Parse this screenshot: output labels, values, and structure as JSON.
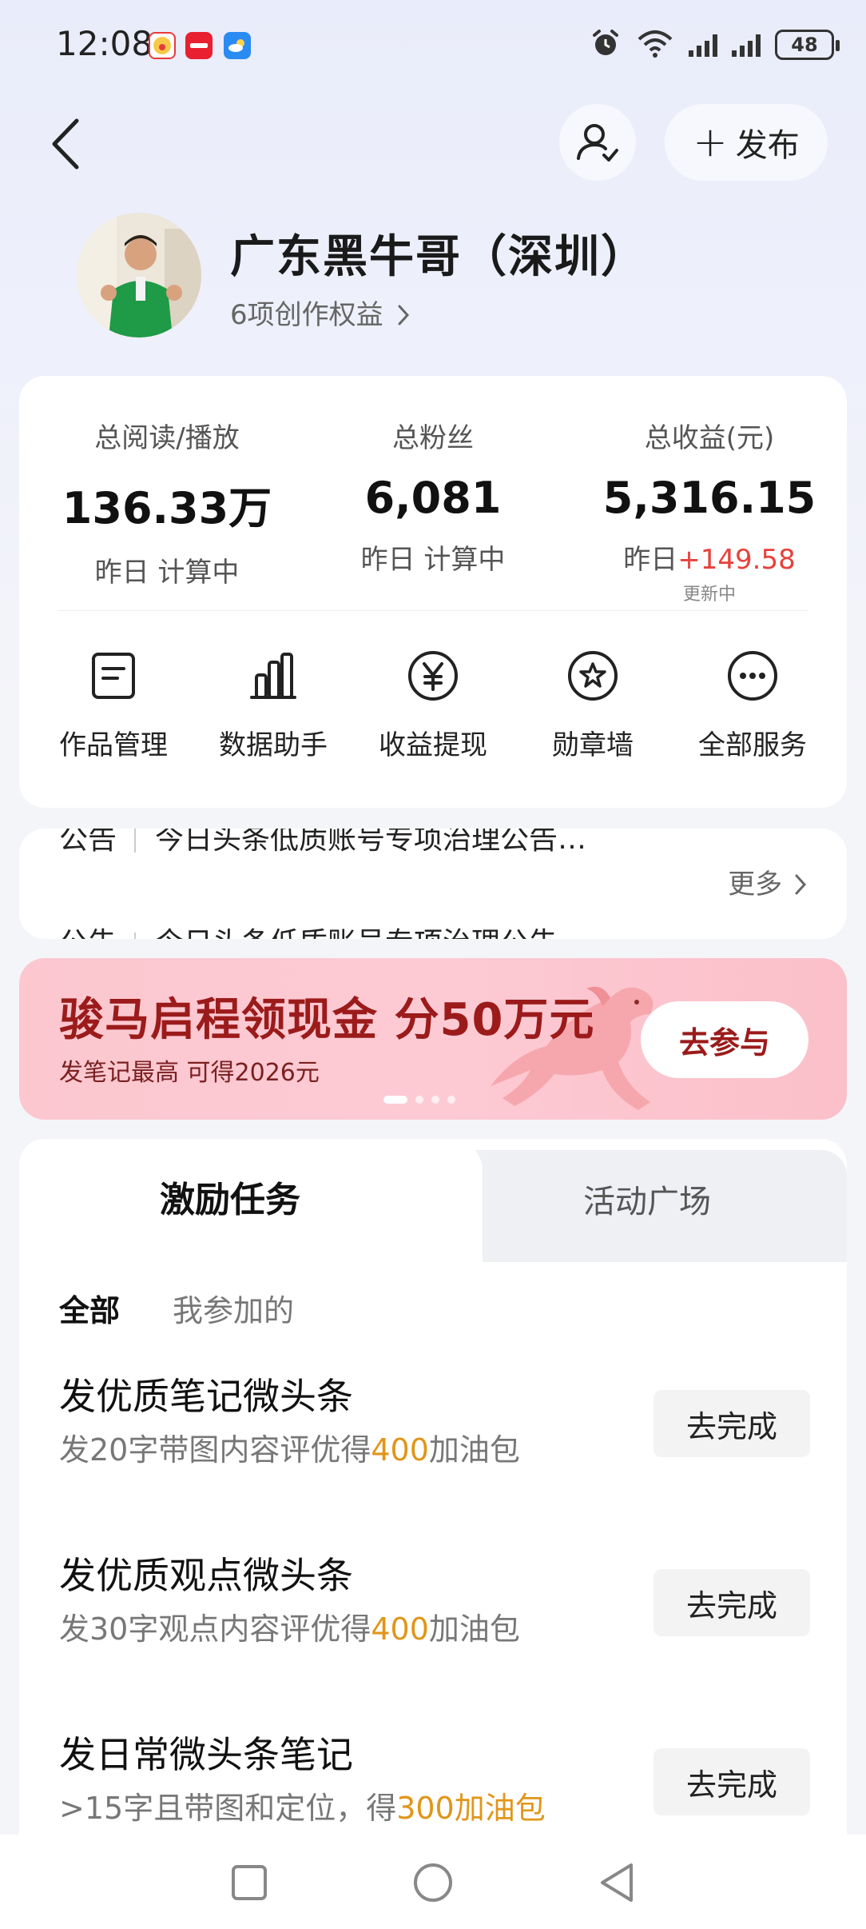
{
  "status_bar": {
    "time": "12:08",
    "battery": "48",
    "app_icons": [
      {
        "name": "clown-app-icon",
        "color": "#e93a3a"
      },
      {
        "name": "xiaohongshu-app-icon",
        "color": "#e8202f"
      },
      {
        "name": "weather-app-icon",
        "color": "#2a8bf2"
      }
    ]
  },
  "header": {
    "publish_label": "发布"
  },
  "profile": {
    "name": "广东黑牛哥（深圳）",
    "rights": "6项创作权益"
  },
  "stats": [
    {
      "label": "总阅读/播放",
      "value": "136.33万",
      "sub": "昨日 计算中"
    },
    {
      "label": "总粉丝",
      "value": "6,081",
      "sub": "昨日 计算中"
    },
    {
      "label": "总收益(元)",
      "value": "5,316.15",
      "sub_prefix": "昨日",
      "sub_delta": "+149.58",
      "updating": "更新中"
    }
  ],
  "services": [
    {
      "label": "作品管理",
      "icon": "document-icon"
    },
    {
      "label": "数据助手",
      "icon": "bar-chart-icon"
    },
    {
      "label": "收益提现",
      "icon": "yuan-icon"
    },
    {
      "label": "勋章墙",
      "icon": "medal-icon"
    },
    {
      "label": "全部服务",
      "icon": "more-icon"
    }
  ],
  "notice": {
    "tag": "公告",
    "text": "今日头条低质账号专项治理公告…",
    "text_next": "今日头条低质账号专项治理公告",
    "more": "更多"
  },
  "banner": {
    "title": "骏马启程领现金 分50万元",
    "subtitle": "发笔记最高 可得2026元",
    "button": "去参与",
    "accent": "#9b1b1b"
  },
  "tabs": {
    "incentive": "激励任务",
    "activity": "活动广场"
  },
  "filters": {
    "all": "全部",
    "mine": "我参加的"
  },
  "tasks": [
    {
      "title": "发优质笔记微头条",
      "desc_pre": "发20字带图内容评优得",
      "desc_hl": "400",
      "desc_post": "加油包",
      "button": "去完成"
    },
    {
      "title": "发优质观点微头条",
      "desc_pre": "发30字观点内容评优得",
      "desc_hl": "400",
      "desc_post": "加油包",
      "button": "去完成"
    },
    {
      "title": "发日常微头条笔记",
      "desc_pre": ">15字且带图和定位，得",
      "desc_hl": "300加油包",
      "desc_post": "",
      "button": "去完成"
    }
  ],
  "colors": {
    "highlight": "#e0961a",
    "positive": "#e8413c"
  }
}
